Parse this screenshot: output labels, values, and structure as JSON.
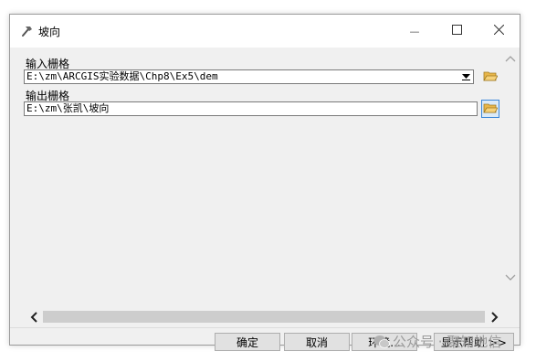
{
  "window": {
    "title": "坡向",
    "title_icon": "hammer-icon",
    "minimize_glyph": "—",
    "maximize_glyph": "☐",
    "close_glyph": "✕"
  },
  "form": {
    "input_raster": {
      "label": "输入栅格",
      "value": "E:\\zm\\ARCGIS实验数据\\Chp8\\Ex5\\dem"
    },
    "output_raster": {
      "label": "输出栅格",
      "value": "E:\\zm\\张凯\\坡向"
    }
  },
  "buttons": {
    "ok": "确定",
    "cancel": "取消",
    "environments": "环境...",
    "show_help": "显示帮助 >>"
  },
  "watermark": {
    "text": "公众号 · 聚知地信"
  },
  "colors": {
    "window_bg": "#f0f0f0",
    "accent": "#3a86d8",
    "folder_yellow": "#e8b64a"
  }
}
